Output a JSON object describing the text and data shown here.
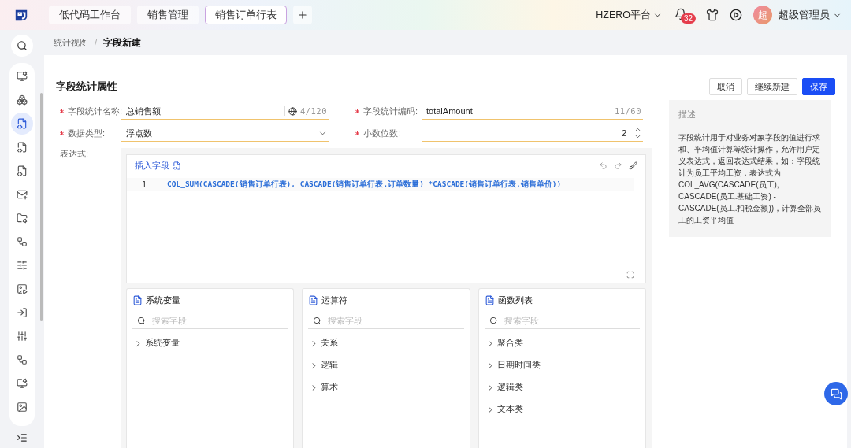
{
  "topbar": {
    "tabs": [
      {
        "label": "低代码工作台",
        "selected": false
      },
      {
        "label": "销售管理",
        "selected": false
      },
      {
        "label": "销售订单行表",
        "selected": true
      }
    ],
    "platform": "HZERO平台",
    "notification_count": "32",
    "avatar": "超",
    "user": "超级管理员"
  },
  "sidebar": {
    "items": [
      {
        "selected": false
      },
      {
        "selected": false
      },
      {
        "selected": true
      },
      {
        "selected": false
      },
      {
        "selected": false
      },
      {
        "selected": false
      },
      {
        "selected": false
      },
      {
        "selected": false
      },
      {
        "selected": false
      },
      {
        "selected": false
      },
      {
        "selected": false
      },
      {
        "selected": false
      },
      {
        "selected": false
      },
      {
        "selected": false
      },
      {
        "selected": false
      }
    ]
  },
  "breadcrumb": [
    {
      "label": "统计视图"
    },
    {
      "label": "字段新建"
    }
  ],
  "breadcrumb_separator": "/",
  "form": {
    "title": "字段统计属性",
    "buttons": [
      {
        "label": "取消",
        "kind": "default"
      },
      {
        "label": "继续新建",
        "kind": "default"
      },
      {
        "label": "保存",
        "kind": "primary"
      }
    ],
    "fields": [
      {
        "label": "字段统计名称:",
        "required": true,
        "kind": "text",
        "value": "总销售额",
        "translatable": true,
        "counter": "4/120"
      },
      {
        "label": "字段统计编码:",
        "required": true,
        "kind": "text",
        "value": "totalAmount",
        "translatable": false,
        "counter": "11/60"
      },
      {
        "label": "数据类型:",
        "required": true,
        "kind": "select",
        "value": "浮点数"
      },
      {
        "label": "小数位数:",
        "required": true,
        "kind": "number",
        "value": "2"
      }
    ],
    "expression": {
      "label": "表达式:",
      "insert_field": "插入字段",
      "lines": [
        {
          "number": "1",
          "code": "COL_SUM(CASCADE(销售订单行表), CASCADE(销售订单行表.订单数量) *CASCADE(销售订单行表.销售单价))"
        }
      ]
    },
    "panels": [
      {
        "title": "系统变量",
        "search_placeholder": "搜索字段",
        "items": [
          {
            "label": "系统变量",
            "expanded": false
          }
        ]
      },
      {
        "title": "运算符",
        "search_placeholder": "搜索字段",
        "items": [
          {
            "label": "关系",
            "expanded": false
          },
          {
            "label": "逻辑",
            "expanded": false
          },
          {
            "label": "算术",
            "expanded": false
          }
        ]
      },
      {
        "title": "函数列表",
        "search_placeholder": "搜索字段",
        "items": [
          {
            "label": "聚合类",
            "expanded": false
          },
          {
            "label": "日期时间类",
            "expanded": false
          },
          {
            "label": "逻辑类",
            "expanded": false
          },
          {
            "label": "文本类",
            "expanded": false
          }
        ]
      }
    ]
  },
  "description": {
    "title": "描述",
    "text": "字段统计用于对业务对象字段的值进行求和、平均值计算等统计操作，允许用户定义表达式，返回表达式结果，如：字段统计为员工平均工资，表达式为 COL_AVG(CASCADE(员工), CASCADE(员工.基础工资) - CASCADE(员工.扣税金额))，计算全部员工的工资平均值"
  }
}
